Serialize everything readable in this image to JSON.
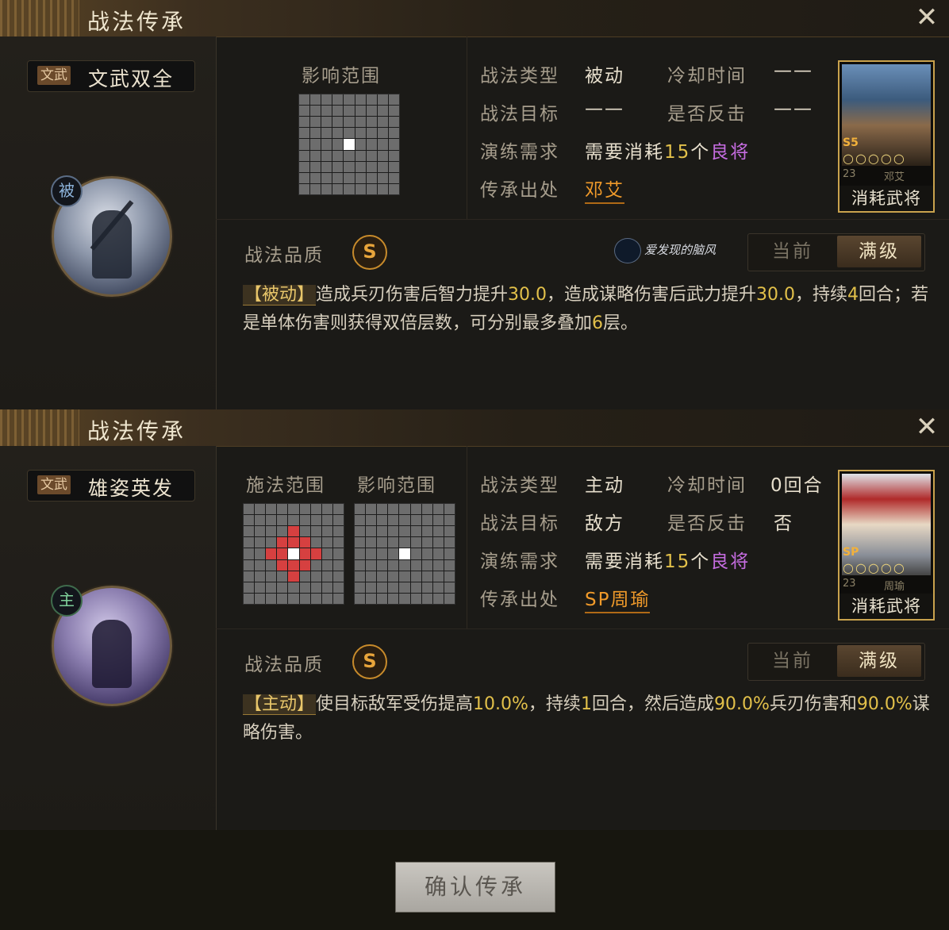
{
  "panels": [
    {
      "title": "战法传承",
      "skill": {
        "badge": "文武",
        "name": "文武双全",
        "type_char": "被"
      },
      "range": {
        "cast_label": "",
        "effect_label": "影响范围"
      },
      "info": {
        "type_label": "战法类型",
        "type_value": "被动",
        "cooldown_label": "冷却时间",
        "cooldown_value": "——",
        "target_label": "战法目标",
        "target_value": "——",
        "counter_label": "是否反击",
        "counter_value": "——",
        "req_label": "演练需求",
        "req_prefix": "需要消耗",
        "req_num": "15",
        "req_unit": "个",
        "req_grade": "良将",
        "source_label": "传承出处",
        "source_value": "邓艾"
      },
      "card": {
        "rarity": "S5",
        "stars": "○○○○○",
        "cost": "23",
        "name": "邓艾",
        "caption": "消耗武将"
      },
      "quality_label": "战法品质",
      "quality_value": "S",
      "watermark": "爱发现的脑风",
      "level_current": "当前",
      "level_max": "满级",
      "desc": {
        "tag": "【被动】",
        "segments": [
          "造成兵刃伤害后智力提升",
          "30.0",
          "，造成谋略伤害后武力提升",
          "30.0",
          "，持续",
          "4",
          "回合；若是单体伤害则获得双倍层数，可分别最多叠加",
          "6",
          "层。"
        ]
      }
    },
    {
      "title": "战法传承",
      "skill": {
        "badge": "文武",
        "name": "雄姿英发",
        "type_char": "主"
      },
      "range": {
        "cast_label": "施法范围",
        "effect_label": "影响范围"
      },
      "info": {
        "type_label": "战法类型",
        "type_value": "主动",
        "cooldown_label": "冷却时间",
        "cooldown_value": "0回合",
        "target_label": "战法目标",
        "target_value": "敌方",
        "counter_label": "是否反击",
        "counter_value": "否",
        "req_label": "演练需求",
        "req_prefix": "需要消耗",
        "req_num": "15",
        "req_unit": "个",
        "req_grade": "良将",
        "source_label": "传承出处",
        "source_value": "SP周瑜"
      },
      "card": {
        "rarity": "SP",
        "stars": "○○○○○",
        "cost": "23",
        "name": "周瑜",
        "caption": "消耗武将"
      },
      "quality_label": "战法品质",
      "quality_value": "S",
      "level_current": "当前",
      "level_max": "满级",
      "desc": {
        "tag": "【主动】",
        "segments": [
          "使目标敌军受伤提高",
          "10.0%",
          "，持续",
          "1",
          "回合，然后造成",
          "90.0%",
          "兵刃伤害和",
          "90.0%",
          "谋略伤害。"
        ]
      }
    }
  ],
  "confirm_label": "确认传承",
  "colors": {
    "accent_gold": "#e2c04a",
    "source_orange": "#f09a2a",
    "grade_purple": "#c56ce0",
    "range_red": "#d64040"
  }
}
